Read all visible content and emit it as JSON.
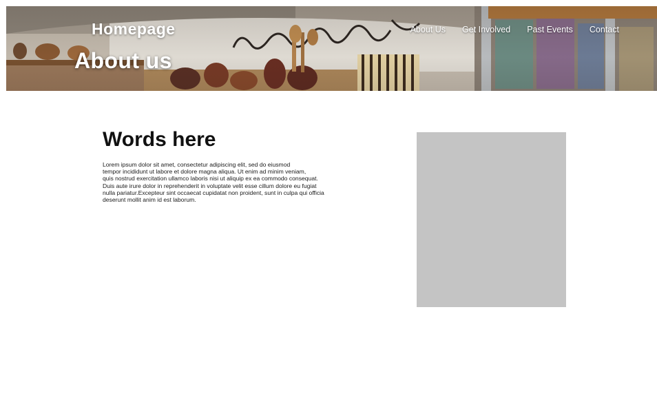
{
  "header": {
    "site_title": "Homepage",
    "page_heading": "About us",
    "nav": [
      {
        "label": "About Us"
      },
      {
        "label": "Get Involved"
      },
      {
        "label": "Past Events"
      },
      {
        "label": "Contact"
      }
    ]
  },
  "main": {
    "title": "Words here",
    "body_lines": [
      "Lorem ipsum dolor sit amet, consectetur adipiscing elit, sed do eiusmod",
      "tempor incididunt ut labore et dolore magna aliqua. Ut enim ad minim veniam,",
      "quis nostrud exercitation ullamco laboris nisi ut aliquip ex ea commodo consequat.",
      "Duis aute irure dolor in reprehenderit in voluptate velit esse cillum dolore eu fugiat",
      "nulla pariatur.Excepteur sint occaecat cupidatat non proident, sunt in culpa qui officia",
      "deserunt mollit anim id est laborum."
    ]
  },
  "colors": {
    "page_background": "#ffffff",
    "placeholder": "#c4c4c4",
    "header_text": "#ffffff",
    "body_text": "#1a1a1a"
  },
  "icons": {
    "banner_image": "pottery-market-stall-photo"
  }
}
